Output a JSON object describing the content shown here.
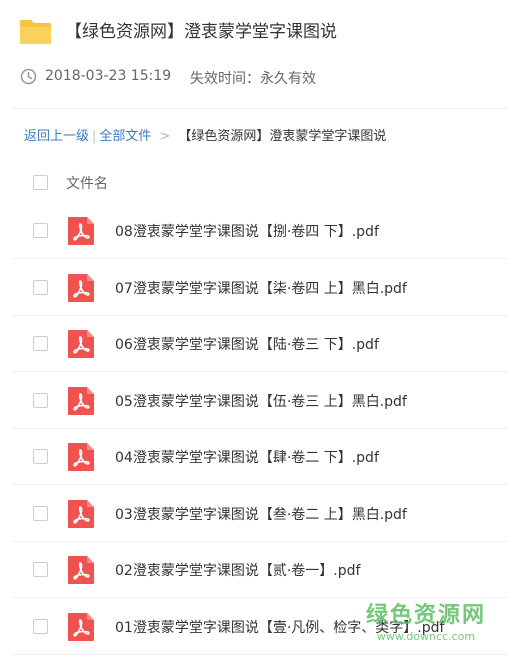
{
  "folder": {
    "title": "【绿色资源网】澄衷蒙学堂字课图说",
    "date": "2018-03-23 15:19",
    "expire_label": "失效时间：永久有效"
  },
  "breadcrumb": {
    "back_label": "返回上一级",
    "separator": "|",
    "all_files_label": "全部文件",
    "arrow": ">",
    "current": "【绿色资源网】澄衷蒙学堂字课图说"
  },
  "list": {
    "header_label": "文件名",
    "files": [
      {
        "name": "08澄衷蒙学堂字课图说【捌·卷四 下】.pdf"
      },
      {
        "name": "07澄衷蒙学堂字课图说【柒·卷四 上】黑白.pdf"
      },
      {
        "name": "06澄衷蒙学堂字课图说【陆·卷三 下】.pdf"
      },
      {
        "name": "05澄衷蒙学堂字课图说【伍·卷三 上】黑白.pdf"
      },
      {
        "name": "04澄衷蒙学堂字课图说【肆·卷二 下】.pdf"
      },
      {
        "name": "03澄衷蒙学堂字课图说【叁·卷二 上】黑白.pdf"
      },
      {
        "name": "02澄衷蒙学堂字课图说【贰·卷一】.pdf"
      },
      {
        "name": "01澄衷蒙学堂字课图说【壹·凡例、检字、类字】.pdf"
      }
    ]
  },
  "watermark": {
    "title": "绿色资源网",
    "url": "www.downcc.com"
  },
  "icons": {
    "folder": "folder-icon",
    "clock": "clock-icon",
    "file": "pdf-icon"
  },
  "colors": {
    "folder": "#f5c542",
    "pdf": "#ef5350",
    "link": "#3b7dc4",
    "watermark": "#5fbf62"
  }
}
